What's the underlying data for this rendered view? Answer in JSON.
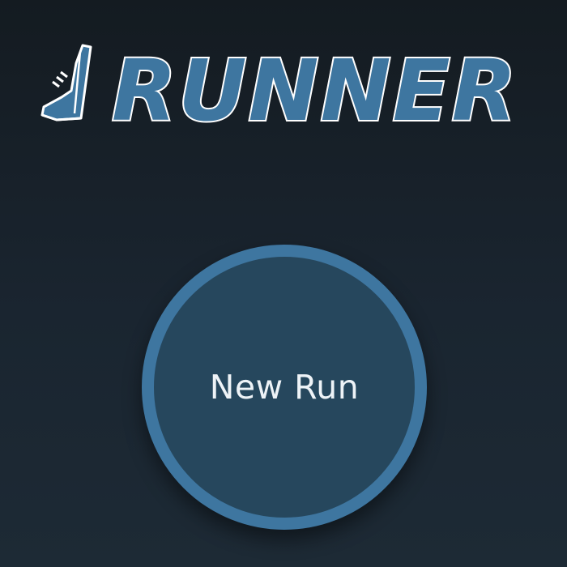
{
  "app": {
    "title": "RUNNER",
    "logo_icon": "sneaker-icon",
    "brand_color": "#3e76a0"
  },
  "main": {
    "new_run_label": "New Run"
  },
  "colors": {
    "background": "#141b21",
    "button_fill": "#26475d",
    "button_ring": "#3e76a0",
    "button_text": "#eef3f7"
  }
}
